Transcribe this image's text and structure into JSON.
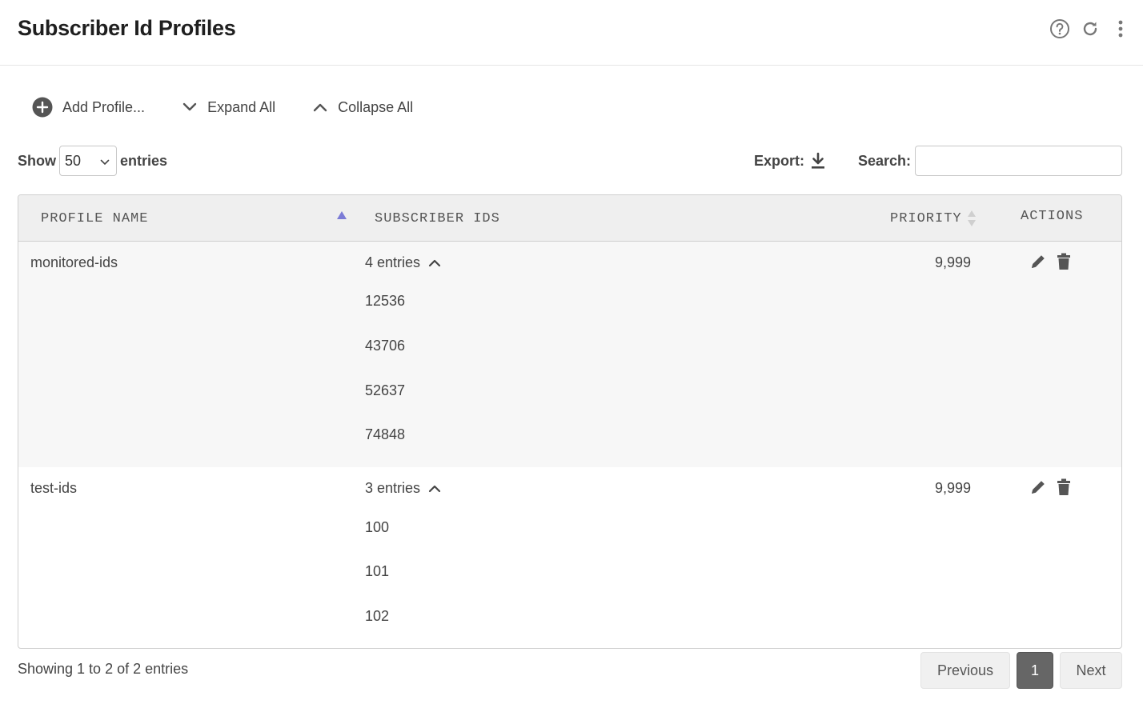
{
  "header": {
    "title": "Subscriber Id Profiles"
  },
  "toolbar": {
    "add_label": "Add Profile...",
    "expand_label": "Expand All",
    "collapse_label": "Collapse All"
  },
  "controls": {
    "show_label": "Show",
    "page_size": "50",
    "entries_label": "entries",
    "export_label": "Export:",
    "search_label": "Search:",
    "search_value": ""
  },
  "table": {
    "columns": [
      "PROFILE NAME",
      "SUBSCRIBER IDS",
      "PRIORITY",
      "ACTIONS"
    ],
    "sorted_column": "PROFILE NAME",
    "sort_direction": "ascending",
    "rows": [
      {
        "name": "monitored-ids",
        "entries_label": "4 entries",
        "ids": [
          "12536",
          "43706",
          "52637",
          "74848"
        ],
        "priority": "9,999"
      },
      {
        "name": "test-ids",
        "entries_label": "3 entries",
        "ids": [
          "100",
          "101",
          "102"
        ],
        "priority": "9,999"
      }
    ]
  },
  "footer": {
    "info": "Showing 1 to 2 of 2 entries",
    "previous_label": "Previous",
    "current_page": "1",
    "next_label": "Next"
  },
  "colors": {
    "sort_active": "#7b7bd6",
    "page_active": "#666666",
    "icon": "#555555"
  }
}
